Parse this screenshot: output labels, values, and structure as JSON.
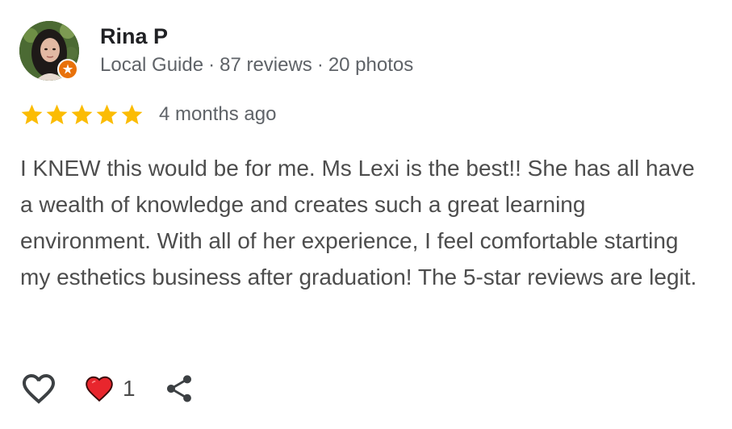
{
  "reviewer": {
    "name": "Rina P",
    "badge": "Local Guide",
    "reviews": "87 reviews",
    "photos": "20 photos",
    "separator": "·",
    "avatar_icon": "profile-photo",
    "badge_icon": "local-guide-star-icon",
    "badge_color": "#e8710a"
  },
  "rating": {
    "stars": 5,
    "max_stars": 5,
    "star_color": "#fbbc04",
    "time": "4 months ago"
  },
  "review": {
    "text": "I KNEW this would be for me. Ms Lexi is the best!! She has all have a wealth of knowledge and creates such a great learning environment. With all of her experience, I feel comfortable starting my esthetics business after graduation! The 5-star reviews are legit."
  },
  "actions": {
    "like_icon": "heart-outline-icon",
    "reaction_icon": "heart-filled-icon",
    "reaction_color": "#e8262d",
    "reaction_count": "1",
    "share_icon": "share-icon"
  }
}
